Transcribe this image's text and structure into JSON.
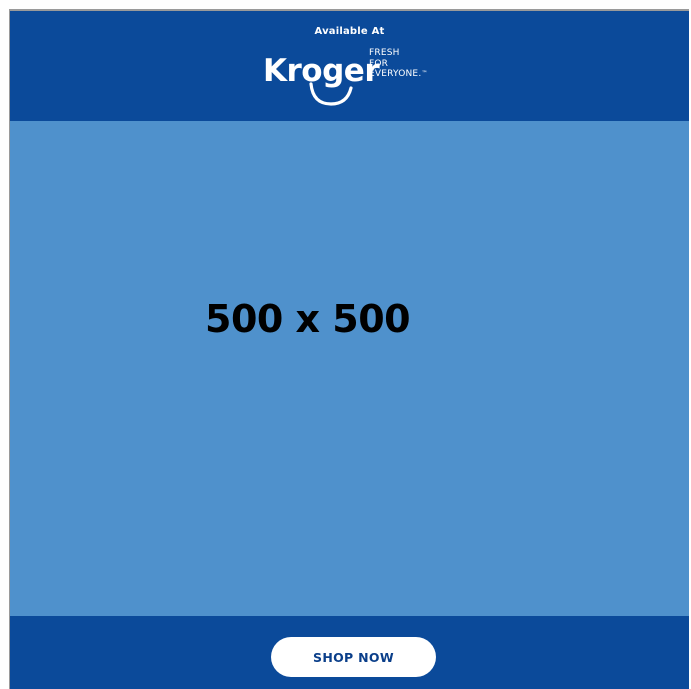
{
  "header": {
    "available_text": "Available At",
    "brand": {
      "wordmark": "Kroger",
      "registered_mark": "®",
      "tagline_line1": "FRESH",
      "tagline_line2": "FOR",
      "tagline_line3": "EVERYONE.",
      "trademark": "™"
    }
  },
  "main": {
    "size_label": "500 x 500"
  },
  "footer": {
    "cta_label": "SHOP NOW"
  },
  "colors": {
    "brand_blue": "#0b4a9a",
    "placeholder_blue": "#4f91cc",
    "button_bg": "#ffffff",
    "button_text": "#0b3f8a"
  }
}
